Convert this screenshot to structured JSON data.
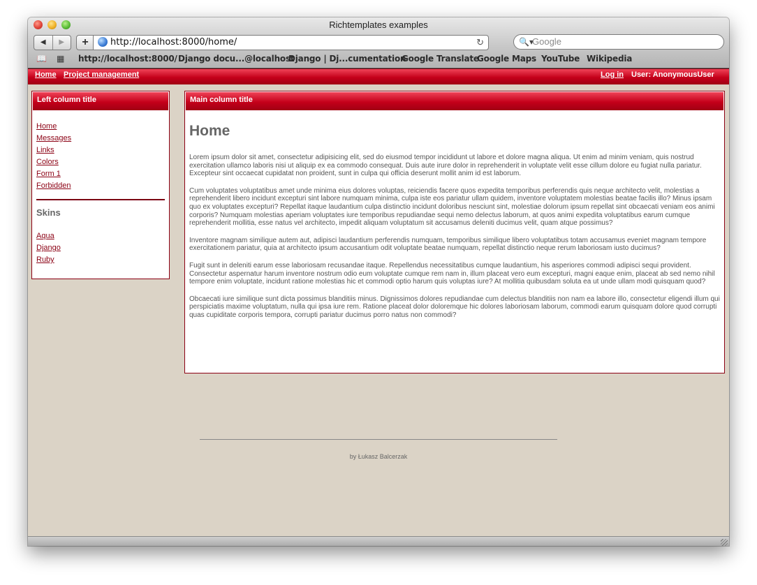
{
  "window": {
    "title": "Richtemplates examples"
  },
  "browser": {
    "url": "http://localhost:8000/home/",
    "search_placeholder": "Google",
    "bookmarks": [
      "http://localhost:8000/",
      "Django docu...@localhost",
      "Django | Dj...cumentation",
      "Google Translate",
      "Google Maps",
      "YouTube",
      "Wikipedia"
    ]
  },
  "topnav": {
    "home": "Home",
    "project_management": "Project management",
    "login": "Log in",
    "user": "User: AnonymousUser"
  },
  "sidebar": {
    "title": "Left column title",
    "links": [
      "Home",
      "Messages",
      "Links",
      "Colors",
      "Form 1",
      "Forbidden"
    ],
    "skins_title": "Skins",
    "skins": [
      "Aqua",
      "Django",
      "Ruby"
    ]
  },
  "main": {
    "title": "Main column title",
    "heading": "Home",
    "paragraphs": [
      "Lorem ipsum dolor sit amet, consectetur adipisicing elit, sed do eiusmod tempor incididunt ut labore et dolore magna aliqua. Ut enim ad minim veniam, quis nostrud exercitation ullamco laboris nisi ut aliquip ex ea commodo consequat. Duis aute irure dolor in reprehenderit in voluptate velit esse cillum dolore eu fugiat nulla pariatur. Excepteur sint occaecat cupidatat non proident, sunt in culpa qui officia deserunt mollit anim id est laborum.",
      "Cum voluptates voluptatibus amet unde minima eius dolores voluptas, reiciendis facere quos expedita temporibus perferendis quis neque architecto velit, molestias a reprehenderit libero incidunt excepturi sint labore numquam minima, culpa iste eos pariatur ullam quidem, inventore voluptatem molestias beatae facilis illo? Minus ipsam quo ex voluptates excepturi? Repellat itaque laudantium culpa distinctio incidunt doloribus nesciunt sint, molestiae dolorum ipsum repellat sint obcaecati veniam eos animi corporis? Numquam molestias aperiam voluptates iure temporibus repudiandae sequi nemo delectus laborum, at quos animi expedita voluptatibus earum cumque reprehenderit mollitia, esse natus vel architecto, impedit aliquam voluptatum sit accusamus deleniti ducimus velit, quam atque possimus?",
      "Inventore magnam similique autem aut, adipisci laudantium perferendis numquam, temporibus similique libero voluptatibus totam accusamus eveniet magnam tempore exercitationem pariatur, quia at architecto ipsum accusantium odit voluptate beatae numquam, repellat distinctio neque rerum laboriosam iusto ducimus?",
      "Fugit sunt in deleniti earum esse laboriosam recusandae itaque. Repellendus necessitatibus cumque laudantium, his asperiores commodi adipisci sequi provident. Consectetur aspernatur harum inventore nostrum odio eum voluptate cumque rem nam in, illum placeat vero eum excepturi, magni eaque enim, placeat ab sed nemo nihil tempore enim voluptate, incidunt ratione molestias hic et commodi optio harum quis voluptas iure? At mollitia quibusdam soluta ea ut unde ullam modi quisquam quod?",
      "Obcaecati iure similique sunt dicta possimus blanditiis minus. Dignissimos dolores repudiandae cum delectus blanditiis non nam ea labore illo, consectetur eligendi illum qui perspiciatis maxime voluptatum, nulla qui ipsa iure rem. Ratione placeat dolor doloremque hic dolores laboriosam laborum, commodi earum quisquam dolore quod corrupti quas cupiditate corporis tempora, corrupti pariatur ducimus porro natus non commodi?"
    ]
  },
  "footer": {
    "text": "by Łukasz Balcerzak"
  }
}
